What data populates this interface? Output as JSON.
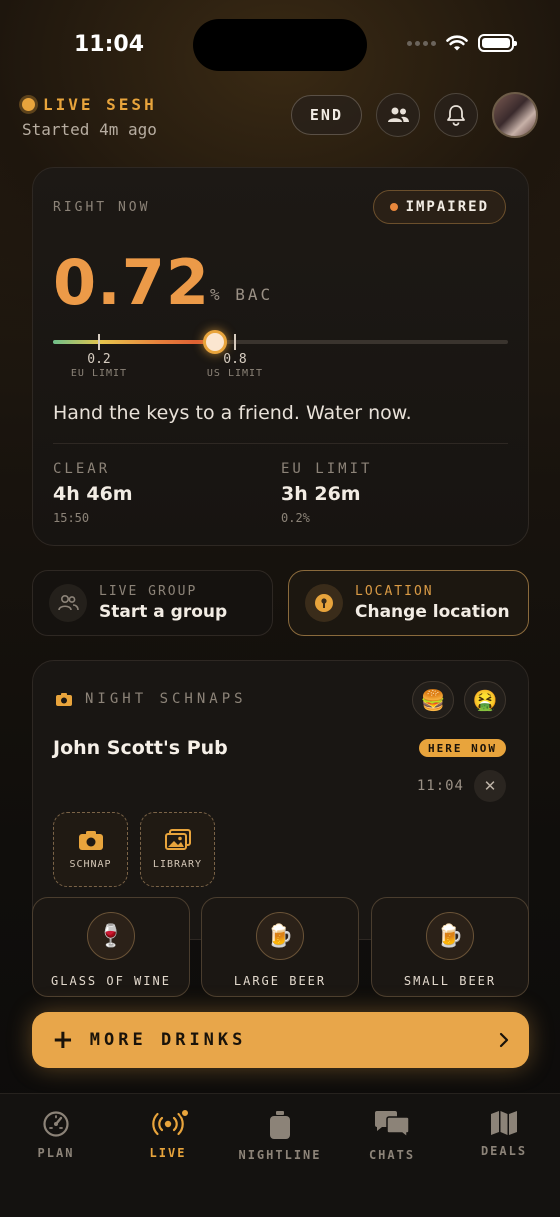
{
  "status_bar": {
    "time": "11:04"
  },
  "header": {
    "live_title": "LIVE SESH",
    "live_subtitle": "Started 4m ago",
    "end_label": "END"
  },
  "bac_card": {
    "heading": "RIGHT NOW",
    "status_badge": "IMPAIRED",
    "value": "0.72",
    "unit": "% BAC",
    "scale_max": 2.0,
    "current_bac": 0.72,
    "markers": [
      {
        "value": "0.2",
        "label": "EU LIMIT"
      },
      {
        "value": "0.8",
        "label": "US LIMIT"
      }
    ],
    "advice": "Hand the keys to a friend. Water now.",
    "stats": [
      {
        "heading": "CLEAR",
        "value": "4h 46m",
        "sub": "15:50"
      },
      {
        "heading": "EU LIMIT",
        "value": "3h 26m",
        "sub": "0.2%"
      }
    ]
  },
  "live_group": {
    "label": "LIVE GROUP",
    "value": "Start a group"
  },
  "location": {
    "label": "LOCATION",
    "value": "Change location"
  },
  "schnaps": {
    "heading": "NIGHT SCHNAPS",
    "emojis": [
      "🍔",
      "🤮"
    ],
    "pub_name": "John Scott's Pub",
    "here_badge": "HERE NOW",
    "time": "11:04",
    "actions": [
      {
        "label": "SCHNAP",
        "icon": "camera-icon"
      },
      {
        "label": "LIBRARY",
        "icon": "gallery-icon"
      }
    ]
  },
  "drinks": [
    {
      "label": "GLASS OF WINE",
      "emoji": "🍷"
    },
    {
      "label": "LARGE BEER",
      "emoji": "🍺"
    },
    {
      "label": "SMALL BEER",
      "emoji": "🍺"
    }
  ],
  "more_drinks": {
    "label": "MORE DRINKS"
  },
  "tabs": [
    {
      "label": "PLAN",
      "icon": "gauge-icon"
    },
    {
      "label": "LIVE",
      "icon": "broadcast-icon",
      "active": true
    },
    {
      "label": "NIGHTLINE",
      "icon": "bottle-icon"
    },
    {
      "label": "CHATS",
      "icon": "chat-bubbles-icon"
    },
    {
      "label": "DEALS",
      "icon": "map-icon"
    }
  ],
  "colors": {
    "accent": "#e8a43c",
    "bac_value": "#ec9a48",
    "background": "#0f0d0b"
  }
}
